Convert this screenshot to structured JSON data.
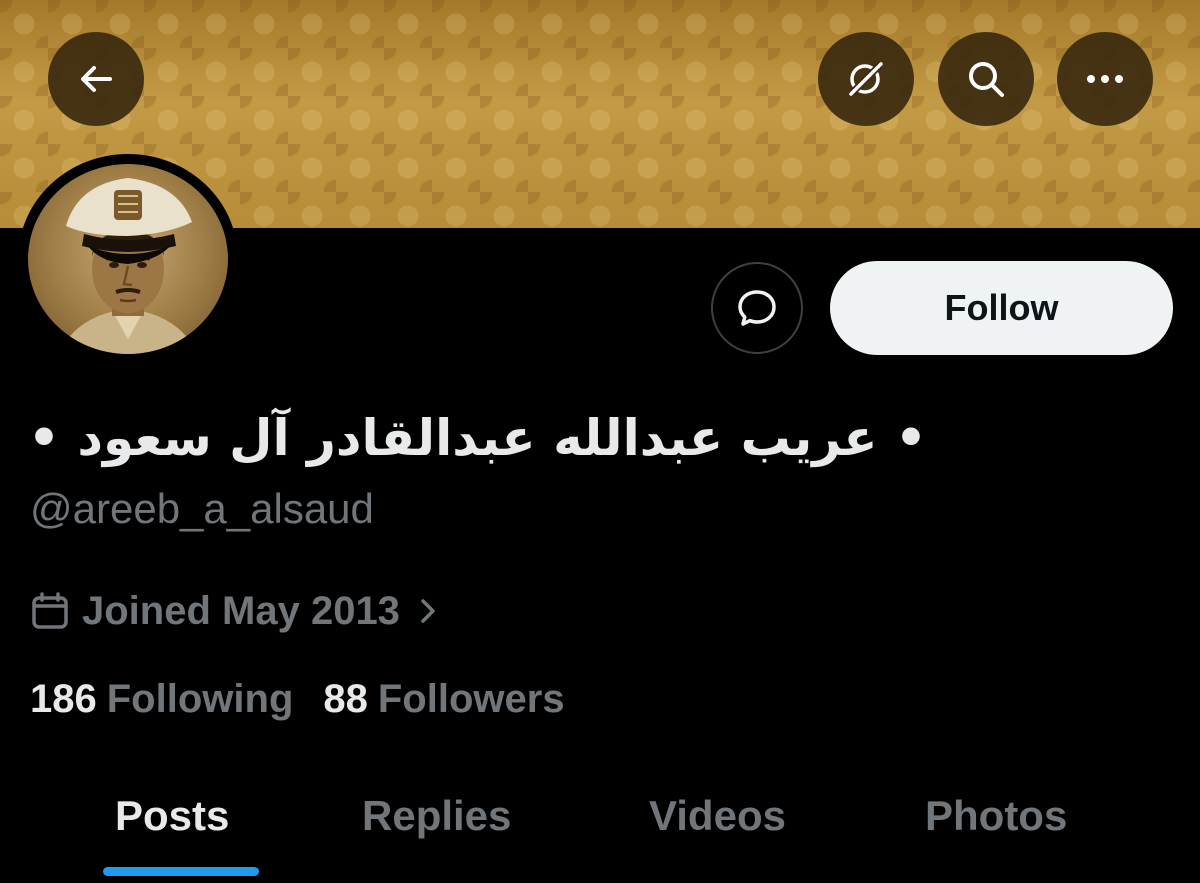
{
  "header": {
    "back_icon": "arrow-left-icon",
    "grok_icon": "grok-icon",
    "search_icon": "search-icon",
    "more_icon": "more-horizontal-icon"
  },
  "profile": {
    "display_name": "• عريب عبدالله عبدالقادر آل سعود •",
    "handle": "@areeb_a_alsaud",
    "joined": "Joined May 2013",
    "following_count": "186",
    "following_label": "Following",
    "followers_count": "88",
    "followers_label": "Followers"
  },
  "actions": {
    "message_icon": "chat-bubble-icon",
    "follow_label": "Follow"
  },
  "tabs": [
    {
      "label": "Posts",
      "active": true
    },
    {
      "label": "Replies",
      "active": false
    },
    {
      "label": "Videos",
      "active": false
    },
    {
      "label": "Photos",
      "active": false
    }
  ],
  "colors": {
    "background": "#000000",
    "primary_text": "#e7e9ea",
    "secondary_text": "#71767b",
    "accent": "#1d9bf0",
    "follow_button": "#eff3f4",
    "banner": "#b58c37"
  }
}
